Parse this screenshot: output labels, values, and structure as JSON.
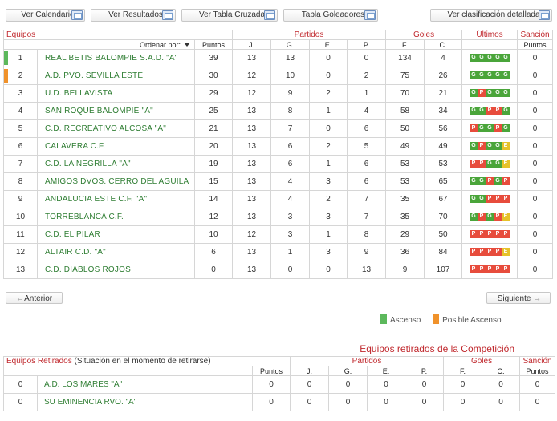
{
  "toolbar": {
    "buttons": [
      "Ver Calendario",
      "Ver Resultados",
      "Ver Tabla Cruzada",
      "Tabla Goleadores",
      "Ver clasificación detallada"
    ]
  },
  "table": {
    "headers": {
      "equipos": "Equipos",
      "partidos": "Partidos",
      "goles": "Goles",
      "ultimos": "Últimos",
      "sancion": "Sanción"
    },
    "subheaders": {
      "ordenar": "Ordenar por:",
      "puntos": "Puntos",
      "j": "J.",
      "g": "G.",
      "e": "E.",
      "p": "P.",
      "f": "F.",
      "c": "C.",
      "sancion_puntos": "Puntos"
    },
    "rows": [
      {
        "pos": "1",
        "team": "REAL BETIS BALOMPIE S.A.D. \"A\"",
        "pts": "39",
        "j": "13",
        "g": "13",
        "e": "0",
        "p": "0",
        "f": "134",
        "c": "4",
        "last": [
          "G",
          "G",
          "G",
          "G",
          "G"
        ],
        "sancion": "0",
        "marker": "ascenso"
      },
      {
        "pos": "2",
        "team": "A.D. PVO. SEVILLA ESTE",
        "pts": "30",
        "j": "12",
        "g": "10",
        "e": "0",
        "p": "2",
        "f": "75",
        "c": "26",
        "last": [
          "G",
          "G",
          "G",
          "G",
          "G"
        ],
        "sancion": "0",
        "marker": "posible"
      },
      {
        "pos": "3",
        "team": "U.D. BELLAVISTA",
        "pts": "29",
        "j": "12",
        "g": "9",
        "e": "2",
        "p": "1",
        "f": "70",
        "c": "21",
        "last": [
          "G",
          "P",
          "G",
          "G",
          "G"
        ],
        "sancion": "0",
        "marker": ""
      },
      {
        "pos": "4",
        "team": "SAN ROQUE BALOMPIE \"A\"",
        "pts": "25",
        "j": "13",
        "g": "8",
        "e": "1",
        "p": "4",
        "f": "58",
        "c": "34",
        "last": [
          "G",
          "G",
          "P",
          "P",
          "G"
        ],
        "sancion": "0",
        "marker": ""
      },
      {
        "pos": "5",
        "team": "C.D. RECREATIVO ALCOSA \"A\"",
        "pts": "21",
        "j": "13",
        "g": "7",
        "e": "0",
        "p": "6",
        "f": "50",
        "c": "56",
        "last": [
          "P",
          "G",
          "G",
          "P",
          "G"
        ],
        "sancion": "0",
        "marker": ""
      },
      {
        "pos": "6",
        "team": "CALAVERA C.F.",
        "pts": "20",
        "j": "13",
        "g": "6",
        "e": "2",
        "p": "5",
        "f": "49",
        "c": "49",
        "last": [
          "G",
          "P",
          "G",
          "G",
          "E"
        ],
        "sancion": "0",
        "marker": ""
      },
      {
        "pos": "7",
        "team": "C.D. LA NEGRILLA \"A\"",
        "pts": "19",
        "j": "13",
        "g": "6",
        "e": "1",
        "p": "6",
        "f": "53",
        "c": "53",
        "last": [
          "P",
          "P",
          "G",
          "G",
          "E"
        ],
        "sancion": "0",
        "marker": ""
      },
      {
        "pos": "8",
        "team": "AMIGOS DVOS. CERRO DEL AGUILA",
        "pts": "15",
        "j": "13",
        "g": "4",
        "e": "3",
        "p": "6",
        "f": "53",
        "c": "65",
        "last": [
          "G",
          "G",
          "P",
          "G",
          "P"
        ],
        "sancion": "0",
        "marker": ""
      },
      {
        "pos": "9",
        "team": "ANDALUCIA ESTE C.F. \"A\"",
        "pts": "14",
        "j": "13",
        "g": "4",
        "e": "2",
        "p": "7",
        "f": "35",
        "c": "67",
        "last": [
          "G",
          "G",
          "P",
          "P",
          "P"
        ],
        "sancion": "0",
        "marker": ""
      },
      {
        "pos": "10",
        "team": "TORREBLANCA C.F.",
        "pts": "12",
        "j": "13",
        "g": "3",
        "e": "3",
        "p": "7",
        "f": "35",
        "c": "70",
        "last": [
          "G",
          "P",
          "G",
          "P",
          "E"
        ],
        "sancion": "0",
        "marker": ""
      },
      {
        "pos": "11",
        "team": "C.D. EL PILAR",
        "pts": "10",
        "j": "12",
        "g": "3",
        "e": "1",
        "p": "8",
        "f": "29",
        "c": "50",
        "last": [
          "P",
          "P",
          "P",
          "P",
          "P"
        ],
        "sancion": "0",
        "marker": ""
      },
      {
        "pos": "12",
        "team": "ALTAIR C.D. \"A\"",
        "pts": "6",
        "j": "13",
        "g": "1",
        "e": "3",
        "p": "9",
        "f": "36",
        "c": "84",
        "last": [
          "P",
          "P",
          "P",
          "P",
          "E"
        ],
        "sancion": "0",
        "marker": ""
      },
      {
        "pos": "13",
        "team": "C.D. DIABLOS ROJOS",
        "pts": "0",
        "j": "13",
        "g": "0",
        "e": "0",
        "p": "13",
        "f": "9",
        "c": "107",
        "last": [
          "P",
          "P",
          "P",
          "P",
          "P"
        ],
        "sancion": "0",
        "marker": ""
      }
    ]
  },
  "nav": {
    "prev": "Anterior",
    "next": "Siguiente"
  },
  "legend": {
    "ascenso": "Ascenso",
    "posible": "Posible Ascenso",
    "ascenso_color": "#5cb85c",
    "posible_color": "#f0922b"
  },
  "retired": {
    "title": "Equipos retirados de la Competición",
    "headers": {
      "equipos": "Equipos Retirados",
      "note": "(Situación en el momento de retirarse)",
      "partidos": "Partidos",
      "goles": "Goles",
      "sancion": "Sanción"
    },
    "subheaders": {
      "puntos": "Puntos",
      "j": "J.",
      "g": "G.",
      "e": "E.",
      "p": "P.",
      "f": "F.",
      "c": "C.",
      "sancion_puntos": "Puntos"
    },
    "rows": [
      {
        "pos": "0",
        "team": "A.D. LOS MARES \"A\"",
        "pts": "0",
        "j": "0",
        "g": "0",
        "e": "0",
        "p": "0",
        "f": "0",
        "c": "0",
        "sancion": "0"
      },
      {
        "pos": "0",
        "team": "SU EMINENCIA RVO. \"A\"",
        "pts": "0",
        "j": "0",
        "g": "0",
        "e": "0",
        "p": "0",
        "f": "0",
        "c": "0",
        "sancion": "0"
      }
    ]
  }
}
